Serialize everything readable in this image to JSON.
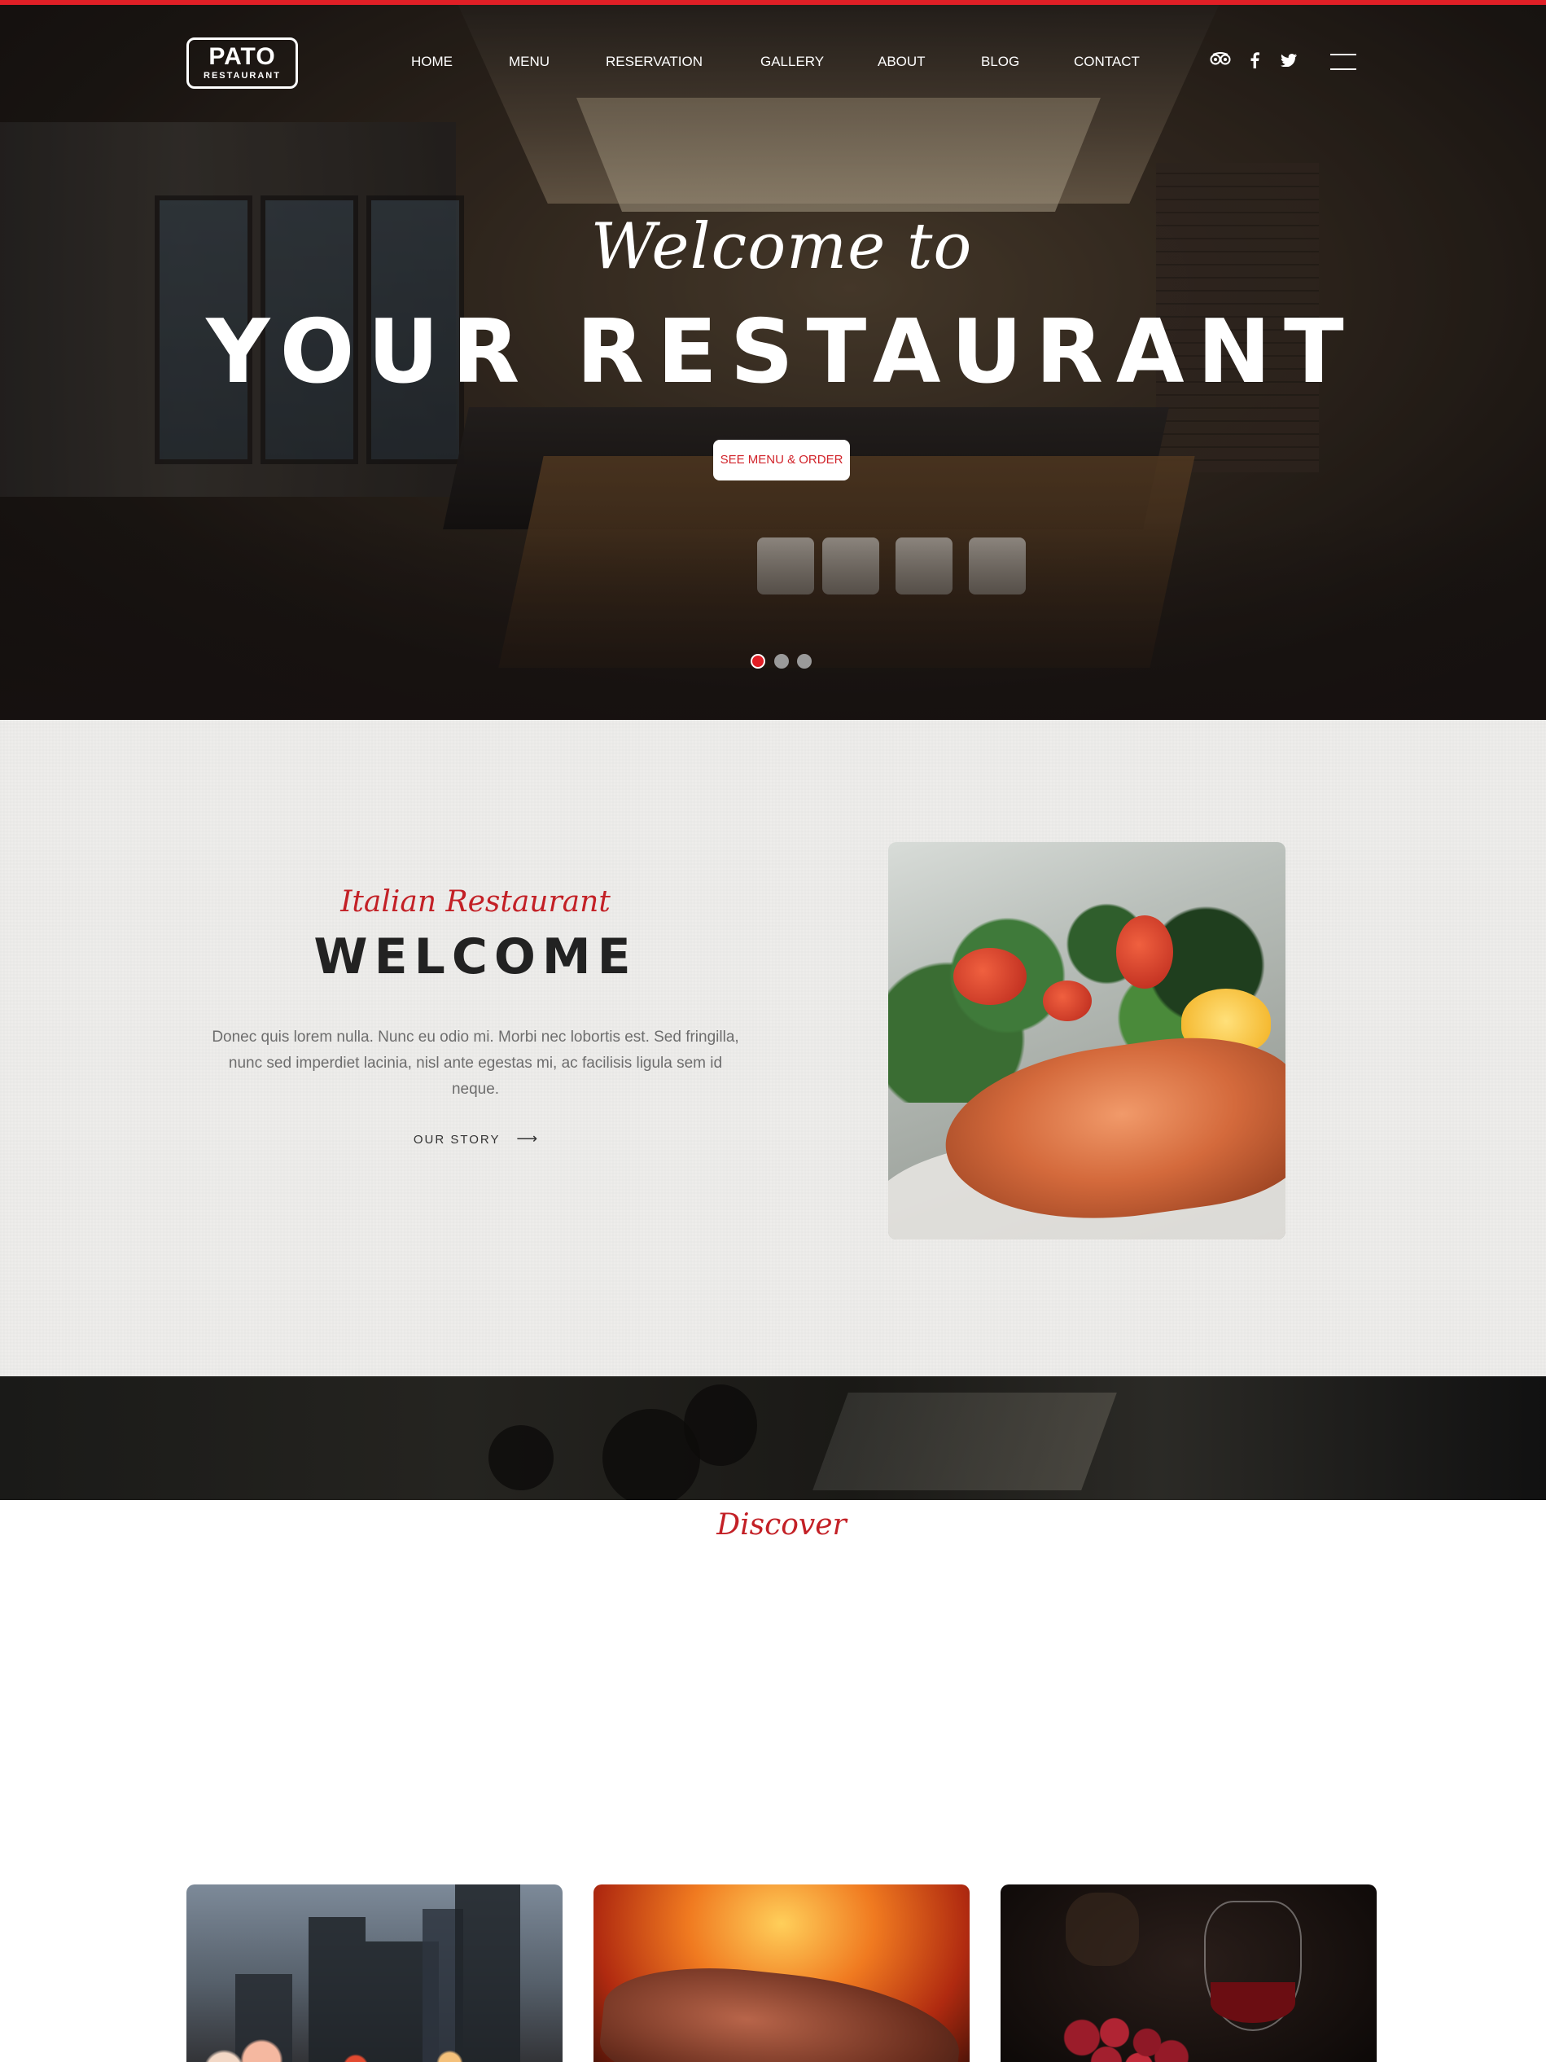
{
  "brand": {
    "name": "PATO",
    "tagline": "RESTAURANT"
  },
  "nav": {
    "items": [
      "HOME",
      "MENU",
      "RESERVATION",
      "GALLERY",
      "ABOUT",
      "BLOG",
      "CONTACT"
    ]
  },
  "social": {
    "tripadvisor": "tripadvisor-icon",
    "facebook": "facebook-icon",
    "twitter": "twitter-icon"
  },
  "hero": {
    "welcome": "Welcome to",
    "title": "YOUR RESTAURANT",
    "button": "SEE MENU & ORDER",
    "active_slide": 1,
    "slide_count": 3
  },
  "welcome": {
    "subtitle": "Italian Restaurant",
    "title": "WELCOME",
    "text": "Donec quis lorem nulla. Nunc eu odio mi. Morbi nec lobortis est. Sed fringilla, nunc sed imperdiet lacinia, nisl ante egestas mi, ac facilisis ligula sem id neque.",
    "link": "OUR STORY",
    "link_arrow": "⟶"
  },
  "discover": {
    "title": "Discover"
  },
  "colors": {
    "accent": "#e01f26",
    "accent_text": "#c32026",
    "dark_text": "#222222",
    "section_bg": "#eeedeb"
  }
}
